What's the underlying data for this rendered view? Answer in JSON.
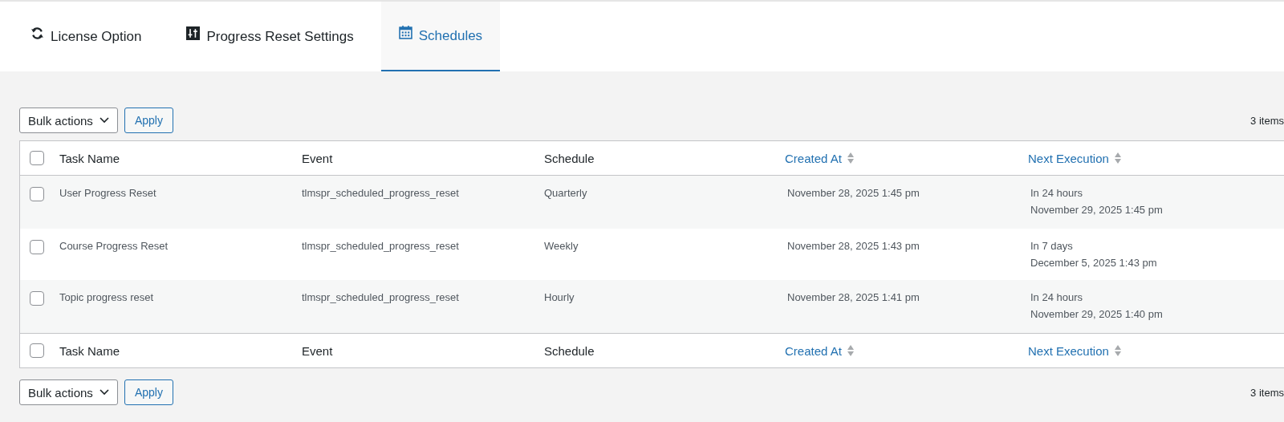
{
  "tabs": [
    {
      "label": "License Option",
      "selected": false
    },
    {
      "label": "Progress Reset Settings",
      "selected": false
    },
    {
      "label": "Schedules",
      "selected": true
    }
  ],
  "top_toolbar": {
    "bulk_actions": "Bulk actions",
    "apply": "Apply",
    "count": "3 items"
  },
  "table": {
    "columns": [
      {
        "label": "Task Name",
        "sortable": false
      },
      {
        "label": "Event",
        "sortable": false
      },
      {
        "label": "Schedule",
        "sortable": false
      },
      {
        "label": "Created At",
        "sortable": true
      },
      {
        "label": "Next Execution",
        "sortable": true
      }
    ],
    "rows": [
      {
        "checked": false,
        "cells": [
          "User Progress Reset",
          "tlmspr_scheduled_progress_reset",
          "Quarterly",
          "November 28, 2025 1:45 pm"
        ],
        "next": [
          "In 24 hours",
          "November 29, 2025 1:45 pm"
        ]
      },
      {
        "checked": false,
        "cells": [
          "Course Progress Reset",
          "tlmspr_scheduled_progress_reset",
          "Weekly",
          "November 28, 2025 1:43 pm"
        ],
        "next": [
          "In 7 days",
          "December 5, 2025 1:43 pm"
        ]
      },
      {
        "checked": false,
        "cells": [
          "Topic progress reset",
          "tlmspr_scheduled_progress_reset",
          "Hourly",
          "November 28, 2025 1:41 pm"
        ],
        "next": [
          "In 24 hours",
          "November 29, 2025 1:40 pm"
        ]
      }
    ],
    "footer_columns": [
      {
        "label": "Task Name",
        "sortable": false
      },
      {
        "label": "Event",
        "sortable": false
      },
      {
        "label": "Schedule",
        "sortable": false
      },
      {
        "label": "Created At",
        "sortable": true
      },
      {
        "label": "Next Execution",
        "sortable": true
      }
    ],
    "header_checked": false,
    "footer_checked": false
  },
  "bottom_toolbar": {
    "bulk_actions": "Bulk actions",
    "apply": "Apply",
    "count": "3 items"
  }
}
